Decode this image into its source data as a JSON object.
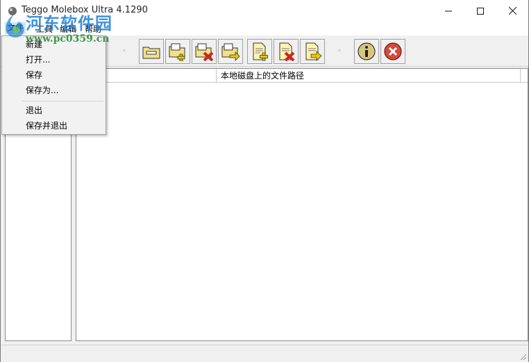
{
  "window": {
    "title": "Teggo Molebox Ultra 4.1290"
  },
  "menubar": {
    "file": "文件",
    "tools": "工具",
    "edit": "编辑",
    "help": "帮助"
  },
  "file_menu": {
    "items": [
      "新建",
      "打开...",
      "保存",
      "保存为...",
      "退出",
      "保存并退出"
    ]
  },
  "toolbar": {
    "separator_glyph": "◦",
    "buttons": [
      "open-folder-icon",
      "add-folder-icon",
      "remove-folder-icon",
      "export-folder-icon",
      "add-file-icon",
      "remove-file-icon",
      "export-file-icon",
      "info-icon",
      "exit-icon"
    ]
  },
  "table": {
    "columns": [
      "",
      "本地磁盘上的文件路径"
    ]
  },
  "watermark": {
    "title": "河东软件园",
    "url": "www.pc0359.cn"
  },
  "colors": {
    "accent": "#1e7fd6",
    "menu_highlight": "#cce4f7"
  }
}
